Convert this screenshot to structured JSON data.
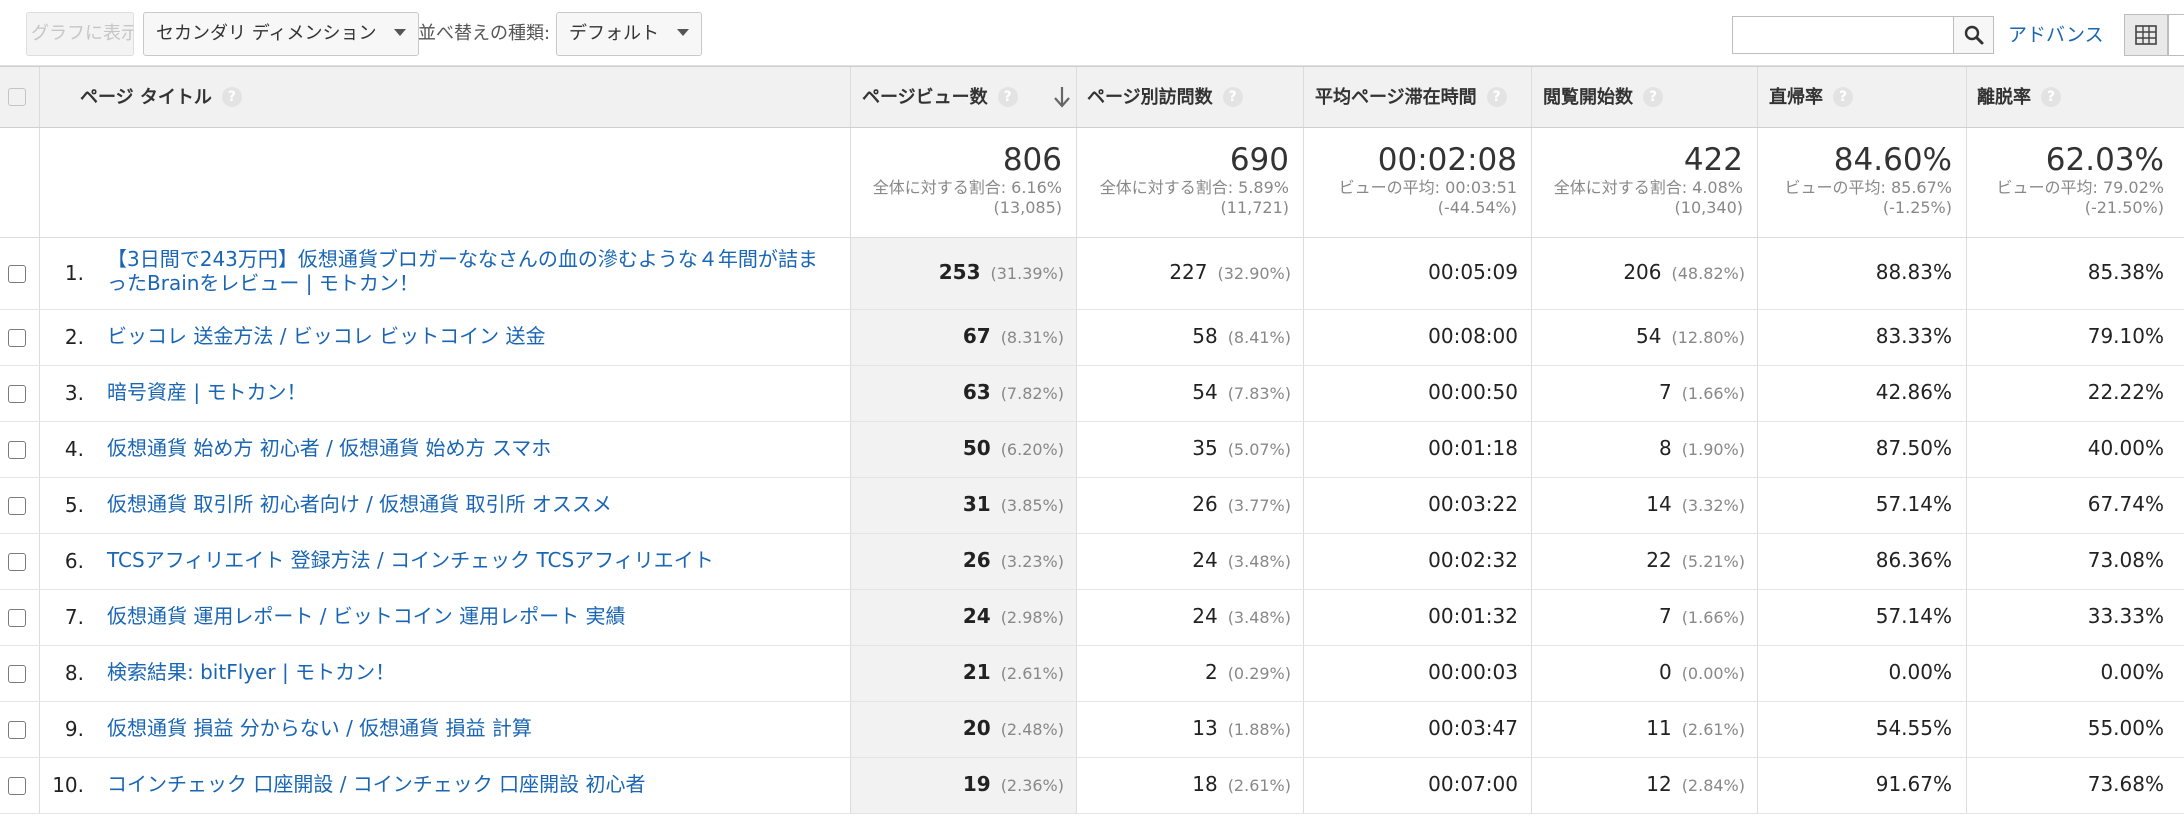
{
  "toolbar": {
    "graph_label": "グラフに表示",
    "secondary_dimension_label": "セカンダリ ディメンション",
    "sort_type_label": "並べ替えの種類:",
    "sort_default_label": "デフォルト",
    "search_placeholder": "",
    "advance_label": "アドバンス"
  },
  "table": {
    "headers": {
      "page_title": "ページ タイトル",
      "pageviews": "ページビュー数",
      "unique_pageviews": "ページ別訪問数",
      "avg_time": "平均ページ滞在時間",
      "entrances": "閲覧開始数",
      "bounce_rate": "直帰率",
      "exit_rate": "離脱率"
    },
    "summary": {
      "pageviews": {
        "value": "806",
        "line1": "全体に対する割合: 6.16%",
        "line2": "(13,085)"
      },
      "unique_pageviews": {
        "value": "690",
        "line1": "全体に対する割合: 5.89%",
        "line2": "(11,721)"
      },
      "avg_time": {
        "value": "00:02:08",
        "line1": "ビューの平均: 00:03:51",
        "line2": "(-44.54%)"
      },
      "entrances": {
        "value": "422",
        "line1": "全体に対する割合: 4.08%",
        "line2": "(10,340)"
      },
      "bounce_rate": {
        "value": "84.60%",
        "line1": "ビューの平均: 85.67%",
        "line2": "(-1.25%)"
      },
      "exit_rate": {
        "value": "62.03%",
        "line1": "ビューの平均: 79.02%",
        "line2": "(-21.50%)"
      }
    },
    "rows": [
      {
        "num": "1.",
        "title": "【3日間で243万円】仮想通貨ブロガーななさんの血の滲むような４年間が詰まったBrainをレビュー | モトカン！",
        "pv": "253",
        "pv_pct": "(31.39%)",
        "upv": "227",
        "upv_pct": "(32.90%)",
        "time": "00:05:09",
        "ent": "206",
        "ent_pct": "(48.82%)",
        "bounce": "88.83%",
        "exit": "85.38%"
      },
      {
        "num": "2.",
        "title": "ビッコレ 送金方法 / ビッコレ ビットコイン 送金",
        "pv": "67",
        "pv_pct": "(8.31%)",
        "upv": "58",
        "upv_pct": "(8.41%)",
        "time": "00:08:00",
        "ent": "54",
        "ent_pct": "(12.80%)",
        "bounce": "83.33%",
        "exit": "79.10%"
      },
      {
        "num": "3.",
        "title": "暗号資産 | モトカン！",
        "pv": "63",
        "pv_pct": "(7.82%)",
        "upv": "54",
        "upv_pct": "(7.83%)",
        "time": "00:00:50",
        "ent": "7",
        "ent_pct": "(1.66%)",
        "bounce": "42.86%",
        "exit": "22.22%"
      },
      {
        "num": "4.",
        "title": "仮想通貨 始め方 初心者 / 仮想通貨 始め方 スマホ",
        "pv": "50",
        "pv_pct": "(6.20%)",
        "upv": "35",
        "upv_pct": "(5.07%)",
        "time": "00:01:18",
        "ent": "8",
        "ent_pct": "(1.90%)",
        "bounce": "87.50%",
        "exit": "40.00%"
      },
      {
        "num": "5.",
        "title": "仮想通貨 取引所 初心者向け / 仮想通貨 取引所 オススメ",
        "pv": "31",
        "pv_pct": "(3.85%)",
        "upv": "26",
        "upv_pct": "(3.77%)",
        "time": "00:03:22",
        "ent": "14",
        "ent_pct": "(3.32%)",
        "bounce": "57.14%",
        "exit": "67.74%"
      },
      {
        "num": "6.",
        "title": "TCSアフィリエイト 登録方法 / コインチェック TCSアフィリエイト",
        "pv": "26",
        "pv_pct": "(3.23%)",
        "upv": "24",
        "upv_pct": "(3.48%)",
        "time": "00:02:32",
        "ent": "22",
        "ent_pct": "(5.21%)",
        "bounce": "86.36%",
        "exit": "73.08%"
      },
      {
        "num": "7.",
        "title": "仮想通貨 運用レポート / ビットコイン 運用レポート 実績",
        "pv": "24",
        "pv_pct": "(2.98%)",
        "upv": "24",
        "upv_pct": "(3.48%)",
        "time": "00:01:32",
        "ent": "7",
        "ent_pct": "(1.66%)",
        "bounce": "57.14%",
        "exit": "33.33%"
      },
      {
        "num": "8.",
        "title": "検索結果: bitFlyer | モトカン！",
        "pv": "21",
        "pv_pct": "(2.61%)",
        "upv": "2",
        "upv_pct": "(0.29%)",
        "time": "00:00:03",
        "ent": "0",
        "ent_pct": "(0.00%)",
        "bounce": "0.00%",
        "exit": "0.00%"
      },
      {
        "num": "9.",
        "title": "仮想通貨 損益 分からない / 仮想通貨 損益 計算",
        "pv": "20",
        "pv_pct": "(2.48%)",
        "upv": "13",
        "upv_pct": "(1.88%)",
        "time": "00:03:47",
        "ent": "11",
        "ent_pct": "(2.61%)",
        "bounce": "54.55%",
        "exit": "55.00%"
      },
      {
        "num": "10.",
        "title": "コインチェック 口座開設 / コインチェック 口座開設 初心者",
        "pv": "19",
        "pv_pct": "(2.36%)",
        "upv": "18",
        "upv_pct": "(2.61%)",
        "time": "00:07:00",
        "ent": "12",
        "ent_pct": "(2.84%)",
        "bounce": "91.67%",
        "exit": "73.68%"
      }
    ]
  },
  "icons": {
    "help": "?",
    "search": "search-icon",
    "sort": "arrow-down-icon",
    "grid": "grid-icon"
  },
  "colors": {
    "link": "#1a66b4",
    "header_bg": "#f1f1f1",
    "sorted_column_bg": "#f2f2f2"
  }
}
